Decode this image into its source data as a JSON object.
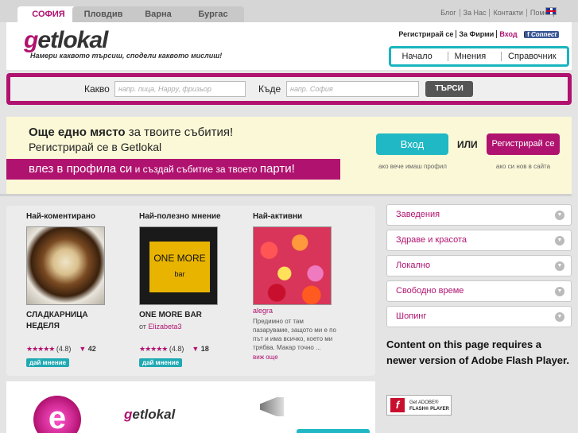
{
  "city_tabs": [
    "СОФИЯ",
    "Пловдив",
    "Варна",
    "Бургас"
  ],
  "top_links": [
    "Блог",
    "За Нас",
    "Контакти",
    "Помощ"
  ],
  "logo": {
    "g": "g",
    "rest": "etlokal"
  },
  "tagline": "Намери каквото търсиш, сподели каквото мислиш!",
  "header_links": {
    "register": "Регистрирай се",
    "firms": "За Фирми",
    "login": "Вход",
    "fb_connect": "Connect"
  },
  "nav": [
    "Начало",
    "Мнения",
    "Справочник"
  ],
  "search": {
    "what_label": "Какво",
    "what_placeholder": "напр. пица, Happy, фризьор",
    "where_label": "Къде",
    "where_placeholder": "напр. София",
    "button": "ТЪРСИ"
  },
  "promo": {
    "line1_bold": "Още едно място",
    "line1_rest": " за твоите събития!",
    "line2": "Регистрирай се в Getlokal",
    "band_a": "влез в профила си",
    "band_b": " и създай събитие за твоето ",
    "band_c": "парти!",
    "login_button": "Вход",
    "or": "ИЛИ",
    "register_button": "Регистрирай се",
    "login_note": "ако вече имаш профил",
    "register_note": "ако си нов в сайта"
  },
  "columns": [
    {
      "title": "Най-коментирано",
      "name": "СЛАДКАРНИЦА НЕДЕЛЯ",
      "stars": "★★★★★",
      "rating": "(4.8)",
      "comments": "42",
      "opinion": "дай мнение"
    },
    {
      "title": "Най-полезно мнение",
      "name": "ONE MORE BAR",
      "by": "от ",
      "by_user": "Elizabeta3",
      "stars": "★★★★★",
      "rating": "(4.8)",
      "comments": "18",
      "opinion": "дай мнение",
      "sign_top": "ONE MORE",
      "sign_bottom": "bar"
    },
    {
      "title": "Най-активни",
      "user": "alegra",
      "quote": "Предимно от там пазаруваме, защото ми е по път и има всичко, което ми трябва. Макар точно ...",
      "more": "виж още"
    }
  ],
  "categories": [
    "Заведения",
    "Здраве и красота",
    "Локално",
    "Свободно време",
    "Шопинг"
  ],
  "flash": {
    "message": "Content on this page requires a newer version of Adobe Flash Player.",
    "btn_line1": "Get ADOBE®",
    "btn_line2": "FLASH® PLAYER"
  },
  "bottom": {
    "e": "e",
    "logo_g": "g",
    "logo_rest": "etlokal"
  }
}
